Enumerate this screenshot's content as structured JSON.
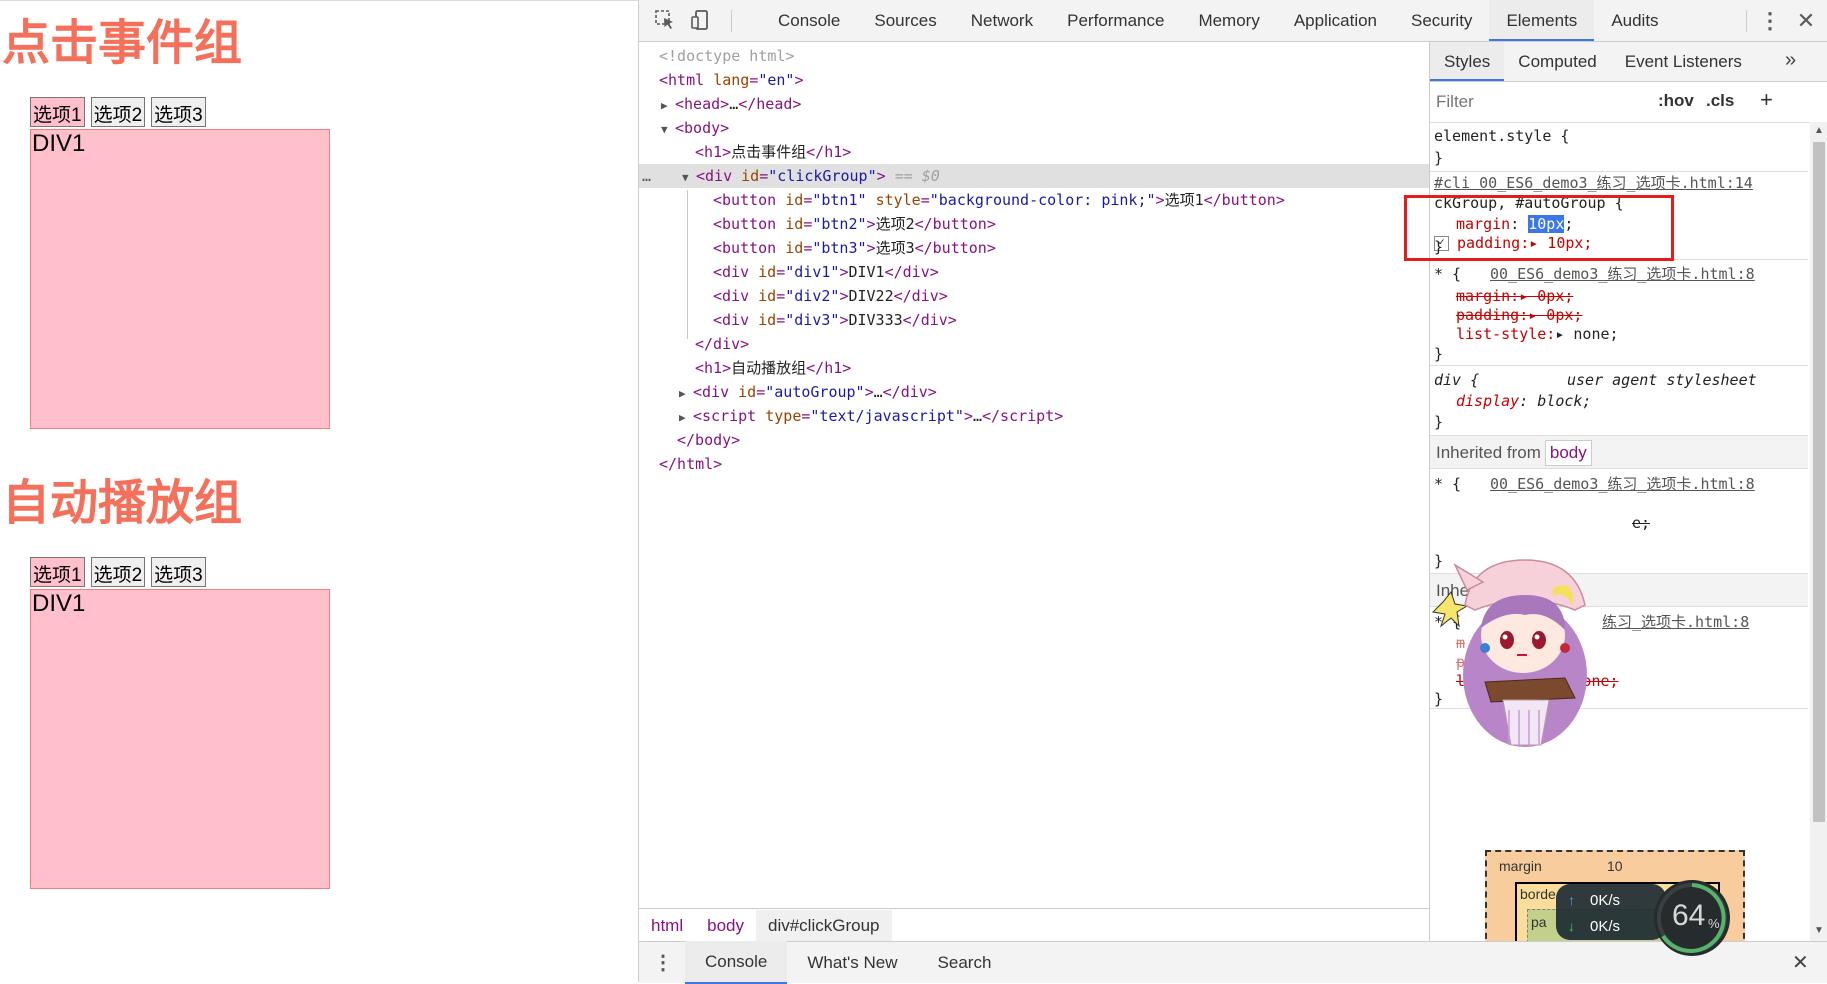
{
  "page": {
    "group1_title": "点击事件组",
    "group2_title": "自动播放组",
    "buttons": [
      "选项1",
      "选项2",
      "选项3"
    ],
    "div_label": "DIV1"
  },
  "devtools": {
    "tabs": [
      "Console",
      "Sources",
      "Network",
      "Performance",
      "Memory",
      "Application",
      "Security",
      "Elements",
      "Audits"
    ],
    "active_tab": "Elements",
    "icons": {
      "inspect": "cursor-arrow-icon",
      "device": "device-toggle-icon",
      "more": "kebab-menu-icon",
      "close": "close-icon"
    },
    "dom": {
      "doctype": "<!doctype html>",
      "html_open_tag": "html",
      "html_attr": "lang",
      "html_attr_val": "\"en\"",
      "head": "head",
      "head_ellipsis": "…",
      "body": "body",
      "h1_1_text": "点击事件组",
      "div_click_id": "\"clickGroup\"",
      "selected_suffix": "== $0",
      "btn1_id": "\"btn1\"",
      "btn1_style": "\"background-color: pink;\"",
      "btn1_text": "选项1",
      "btn2_id": "\"btn2\"",
      "btn2_text": "选项2",
      "btn3_id": "\"btn3\"",
      "btn3_text": "选项3",
      "div1_id": "\"div1\"",
      "div1_text": "DIV1",
      "div2_id": "\"div2\"",
      "div2_text": "DIV22",
      "div3_id": "\"div3\"",
      "div3_text": "DIV333",
      "h1_2_text": "自动播放组",
      "div_auto_id": "\"autoGroup\"",
      "script_type": "\"text/javascript\"",
      "ellipsis": "…"
    },
    "breadcrumb": [
      "html",
      "body",
      "div#clickGroup"
    ],
    "styles_tabs": [
      "Styles",
      "Computed",
      "Event Listeners"
    ],
    "filter_placeholder": "Filter",
    "filter_buttons": {
      "hov": ":hov",
      "cls": ".cls",
      "add": "+"
    },
    "rules": {
      "element_style": "element.style {",
      "close_brace": "}",
      "r1_source": "#cli  00_ES6_demo3_练习_选项卡.html:14",
      "r1_selector": "ckGroup, #autoGroup {",
      "r1_margin_prop": "margin",
      "r1_margin_val": "10px",
      "r1_padding": "padding:▸ 10px;",
      "r2_star": "* {",
      "r2_source": "00_ES6_demo3_练习_选项卡.html:8",
      "r2_margin": "margin:▸ 0px;",
      "r2_padding": "padding:▸ 0px;",
      "r2_list": "list-style:",
      "r2_list_val": "▸ none;",
      "r3_selector": "div {",
      "r3_source": "user agent stylesheet",
      "r3_display": "display",
      "r3_display_val": ": block;",
      "inherited_from": "Inherited from",
      "inherited_chip": "body",
      "r4_source": "00_ES6_demo3_练习_选项卡.html:8",
      "r4_tail": "e;",
      "inh2_partial": "Inhe",
      "r5_source": "练习_选项卡.html:8",
      "r5_m": "m",
      "r5_pad": "pad",
      "r5_list": "list-style:▸ none;"
    },
    "boxmodel": {
      "margin_label": "margin",
      "margin_val": "10",
      "border_label": "borde",
      "padding_label": "pa"
    },
    "drawer_tabs": [
      "Console",
      "What's New",
      "Search"
    ],
    "netwidget": {
      "up": "0K/s",
      "down": "0K/s",
      "percent": "64",
      "percent_unit": "%"
    }
  },
  "colors": {
    "accent": "#3b78e7",
    "pink": "#ffc0cb",
    "title": "#f4705a",
    "annotation": "#e81b1b"
  }
}
